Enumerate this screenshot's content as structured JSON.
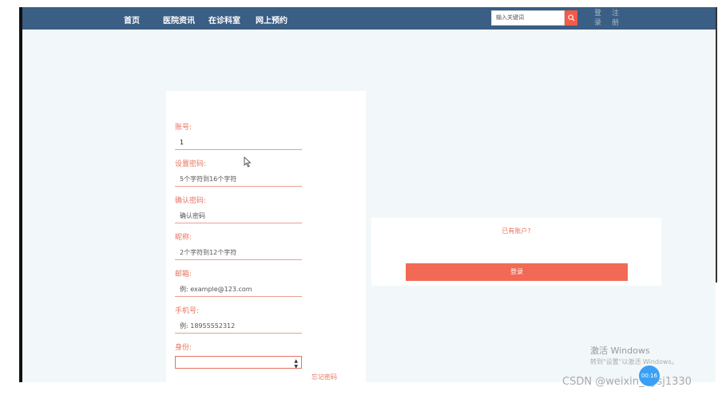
{
  "nav": {
    "items": [
      "首页",
      "医院资讯",
      "在诊科室",
      "网上预约"
    ],
    "search_placeholder": "输入关键词",
    "login_label": "登录",
    "register_label": "注册"
  },
  "registration": {
    "fields": [
      {
        "label": "账号:",
        "value": "1",
        "placeholder": ""
      },
      {
        "label": "设置密码:",
        "value": "",
        "placeholder": "5个字符到16个字符"
      },
      {
        "label": "确认密码:",
        "value": "",
        "placeholder": "确认密码"
      },
      {
        "label": "昵称:",
        "value": "",
        "placeholder": "2个字符到12个字符"
      },
      {
        "label": "邮箱:",
        "value": "",
        "placeholder": "例: example@123.com"
      },
      {
        "label": "手机号:",
        "value": "",
        "placeholder": "例: 18955552312"
      }
    ],
    "role_label": "身份:",
    "role_selected": "",
    "forgot_label": "忘记密码"
  },
  "login_panel": {
    "prompt": "已有账户?",
    "button_label": "登录"
  },
  "overlay": {
    "windows_title": "激活 Windows",
    "windows_sub": "转到\"设置\"以激活 Windows。",
    "watermark": "CSDN @weixin_bysj1330",
    "badge": "00:16"
  },
  "colors": {
    "navbar": "#3a5e84",
    "accent": "#e8735f",
    "button": "#f26a55",
    "background": "#f2f8fa"
  }
}
